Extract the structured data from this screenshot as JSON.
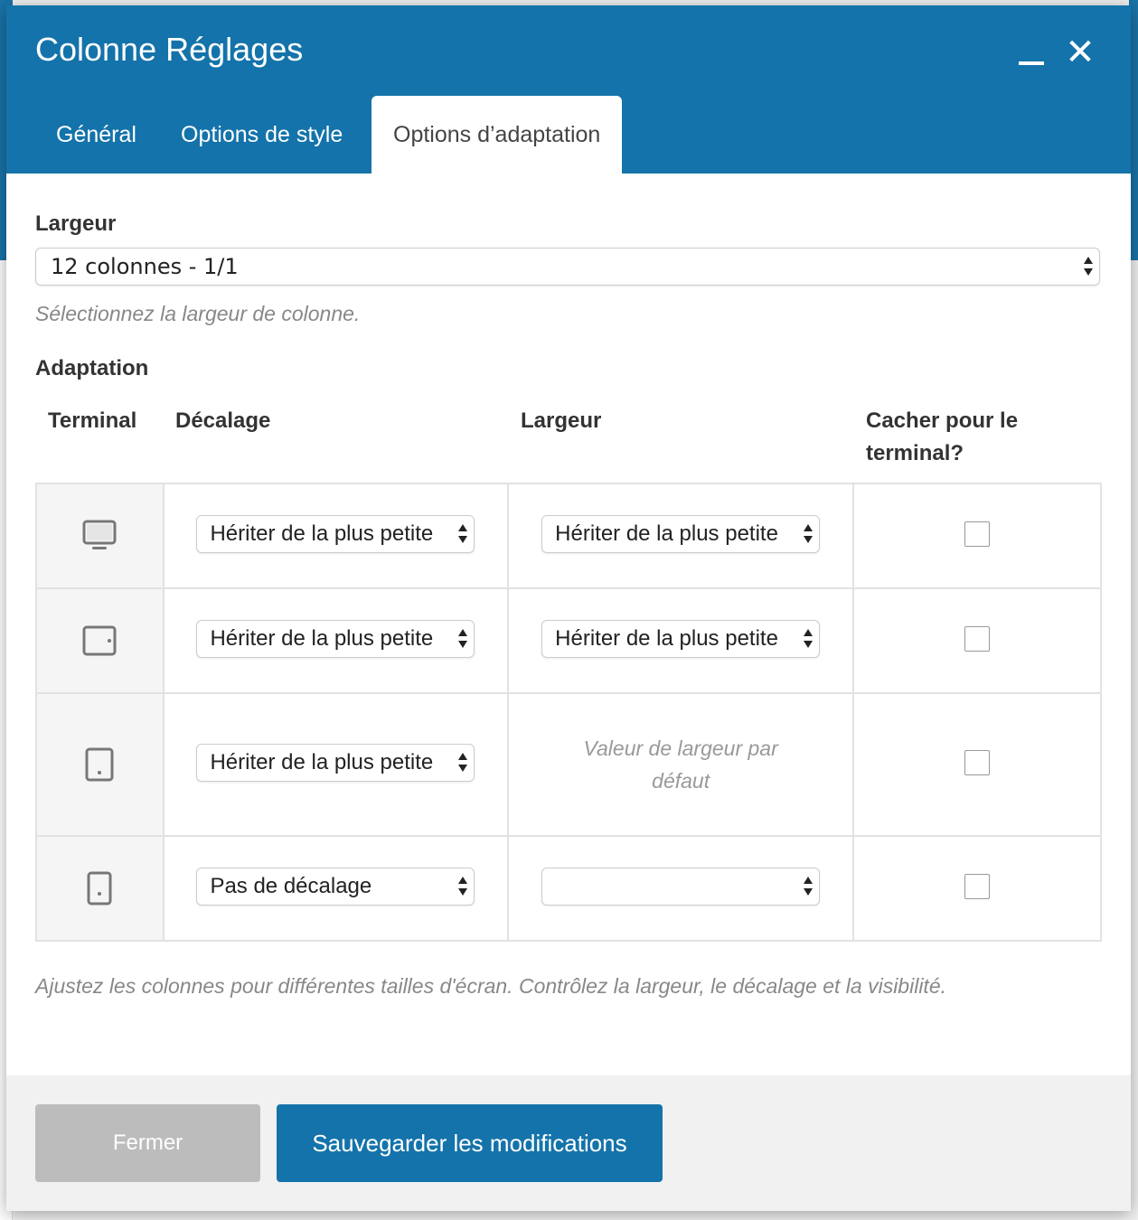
{
  "modal": {
    "title": "Colonne Réglages",
    "tabs": [
      {
        "label": "Général"
      },
      {
        "label": "Options de style"
      },
      {
        "label": "Options d’adaptation"
      }
    ]
  },
  "width": {
    "label": "Largeur",
    "value": "12 colonnes - 1/1",
    "hint": "Sélectionnez la largeur de colonne."
  },
  "responsive": {
    "label": "Adaptation",
    "columns": {
      "device": "Terminal",
      "offset": "Décalage",
      "width": "Largeur",
      "hide": "Cacher pour le terminal?"
    },
    "rows": [
      {
        "device_icon": "desktop-icon",
        "offset": "Hériter de la plus petite",
        "width": "Hériter de la plus petite",
        "hidden": false
      },
      {
        "device_icon": "tablet-landscape-icon",
        "offset": "Hériter de la plus petite",
        "width": "Hériter de la plus petite",
        "hidden": false
      },
      {
        "device_icon": "tablet-portrait-icon",
        "offset": "Hériter de la plus petite",
        "width_default": "Valeur de largeur par défaut",
        "hidden": false
      },
      {
        "device_icon": "phone-icon",
        "offset": "Pas de décalage",
        "width": "",
        "hidden": false
      }
    ],
    "hint": "Ajustez les colonnes pour différentes tailles d'écran. Contrôlez la largeur, le décalage et la visibilité."
  },
  "footer": {
    "close_label": "Fermer",
    "save_label": "Sauvegarder les modifications"
  },
  "colors": {
    "header": "#1473aa",
    "close_button": "#bcbcbc"
  }
}
